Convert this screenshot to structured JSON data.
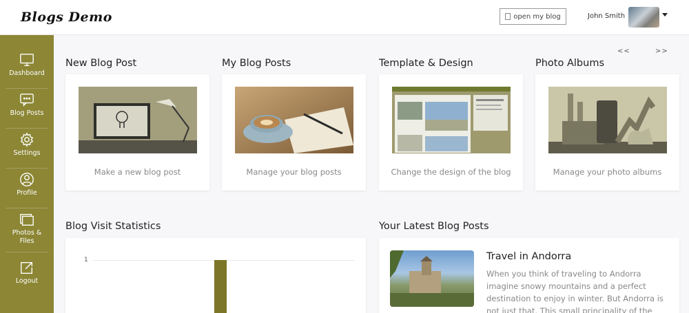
{
  "header": {
    "logo": "Blogs Demo",
    "open_blog_label": "open my blog",
    "user_name": "John Smith"
  },
  "sidebar": {
    "items": [
      {
        "label": "Dashboard",
        "icon": "monitor-icon"
      },
      {
        "label": "Blog Posts",
        "icon": "chat-icon"
      },
      {
        "label": "Settings",
        "icon": "gear-icon"
      },
      {
        "label": "Profile",
        "icon": "user-icon"
      },
      {
        "label": "Photos & Files",
        "icon": "photos-icon"
      },
      {
        "label": "Logout",
        "icon": "logout-icon"
      }
    ]
  },
  "pager": {
    "prev": "<<",
    "next": ">>"
  },
  "cards": [
    {
      "title": "New Blog Post",
      "caption": "Make a new blog post"
    },
    {
      "title": "My Blog Posts",
      "caption": "Manage your blog posts"
    },
    {
      "title": "Template & Design",
      "caption": "Change the design of the blog"
    },
    {
      "title": "Photo Albums",
      "caption": "Manage your photo albums"
    }
  ],
  "stats": {
    "title": "Blog Visit Statistics",
    "chart_data": {
      "type": "bar",
      "ytick": "1",
      "values": [
        1
      ]
    }
  },
  "latest": {
    "title": "Your Latest Blog Posts",
    "post_title": "Travel in Andorra",
    "post_excerpt": "When you think of traveling to Andorra imagine snowy mountains and a perfect destination to enjoy in winter. But Andorra is not just that. This small principality of the"
  },
  "colors": {
    "accent": "#8c8635",
    "bar": "#7c7628"
  }
}
